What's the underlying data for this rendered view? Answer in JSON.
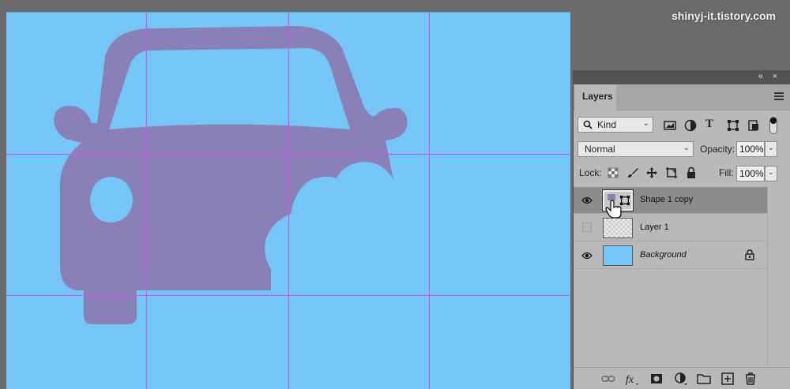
{
  "watermark": "shinyj-it.tistory.com",
  "canvas": {
    "background": "#74c6f6",
    "shape_color": "#8a80b8",
    "guide_color": "#d84bf0"
  },
  "panel": {
    "tab_label": "Layers",
    "filter_kind": "Kind",
    "blend_mode": "Normal",
    "opacity_label": "Opacity:",
    "opacity_value": "100%",
    "lock_label": "Lock:",
    "fill_label": "Fill:",
    "fill_value": "100%",
    "layers": [
      {
        "name": "Shape 1 copy",
        "visible": true,
        "selected": true
      },
      {
        "name": "Layer 1",
        "visible": false,
        "selected": false
      },
      {
        "name": "Background",
        "visible": true,
        "selected": false,
        "locked": true
      }
    ]
  },
  "icons": {
    "collapse": "«",
    "close": "×",
    "search": "search-icon",
    "text_filter": "T"
  }
}
